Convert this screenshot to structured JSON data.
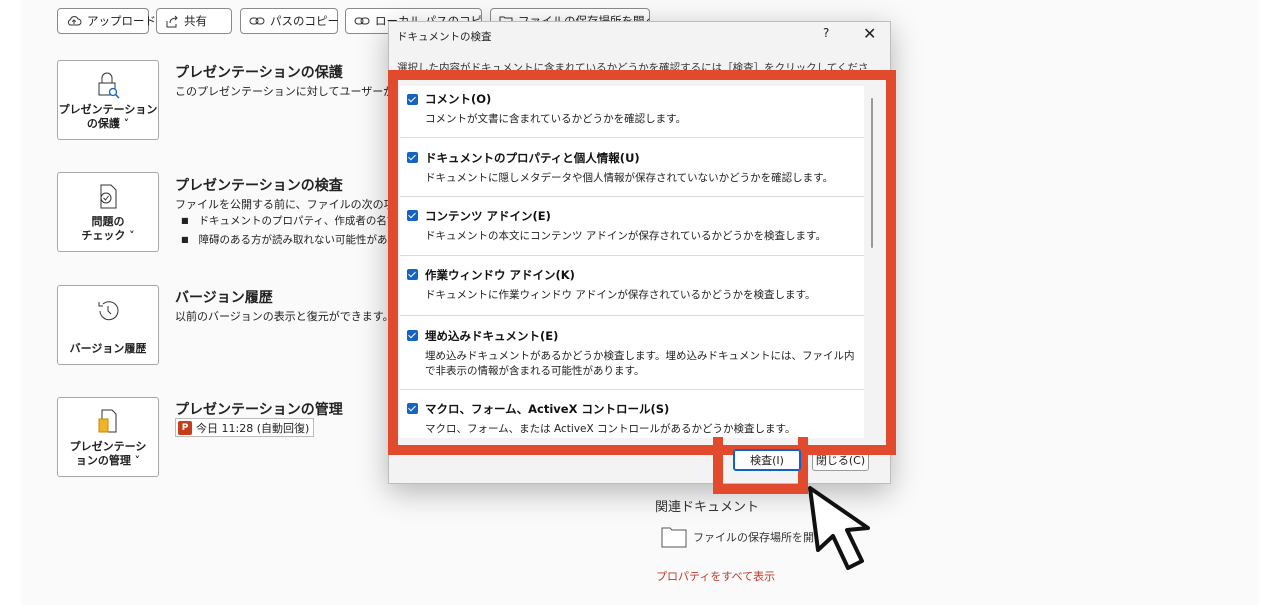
{
  "toolbar": {
    "upload": "アップロード",
    "share": "共有",
    "copy_path": "パスのコピー",
    "copy_local_path": "ローカル パスのコピー",
    "open_location": "ファイルの保存場所を開く"
  },
  "sections": {
    "protect": {
      "button": "プレゼンテーション\nの保護 ˅",
      "title": "プレゼンテーションの保護",
      "desc": "このプレゼンテーションに対してユーザーが行える変更の種類を管理します。"
    },
    "inspect": {
      "button": "問題の\nチェック ˅",
      "title": "プレゼンテーションの検査",
      "desc": "ファイルを公開する前に、ファイルの次の項目を確認します。",
      "bullets": [
        "ドキュメントのプロパティ、作成者の名前",
        "障碍のある方が読み取れない可能性がある内容"
      ]
    },
    "versions": {
      "button": "バージョン履歴",
      "title": "バージョン履歴",
      "desc": "以前のバージョンの表示と復元ができます。"
    },
    "manage": {
      "button": "プレゼンテーシ\nョンの管理 ˅",
      "title": "プレゼンテーションの管理",
      "entry": "今日 11:28 (自動回復)"
    }
  },
  "dialog": {
    "title": "ドキュメントの検査",
    "help": "?",
    "close": "✕",
    "intro": "選択した内容がドキュメントに含まれているかどうかを確認するには［検査］をクリックしてください。",
    "items": [
      {
        "title": "コメント(O)",
        "desc": "コメントが文書に含まれているかどうかを確認します。",
        "checked": true
      },
      {
        "title": "ドキュメントのプロパティと個人情報(U)",
        "desc": "ドキュメントに隠しメタデータや個人情報が保存されていないかどうかを確認します。",
        "checked": true
      },
      {
        "title": "コンテンツ アドイン(E)",
        "desc": "ドキュメントの本文にコンテンツ アドインが保存されているかどうかを検査します。",
        "checked": true
      },
      {
        "title": "作業ウィンドウ アドイン(K)",
        "desc": "ドキュメントに作業ウィンドウ アドインが保存されているかどうかを検査します。",
        "checked": true
      },
      {
        "title": "埋め込みドキュメント(E)",
        "desc": "埋め込みドキュメントがあるかどうか検査します。埋め込みドキュメントには、ファイル内で非表示の情報が含まれる可能性があります。",
        "checked": true
      },
      {
        "title": "マクロ、フォーム、ActiveX コントロール(S)",
        "desc": "マクロ、フォーム、または ActiveX コントロールがあるかどうか検査します。",
        "checked": true
      }
    ],
    "inspect_button": "検査(I)",
    "close_button": "閉じる(C)"
  },
  "related": {
    "title": "関連ドキュメント",
    "open_location": "ファイルの保存場所を開く",
    "all_props": "プロパティをすべて表示"
  },
  "colors": {
    "highlight": "#e24a2d",
    "checkbox": "#1565c0",
    "link": "#c0392b"
  }
}
